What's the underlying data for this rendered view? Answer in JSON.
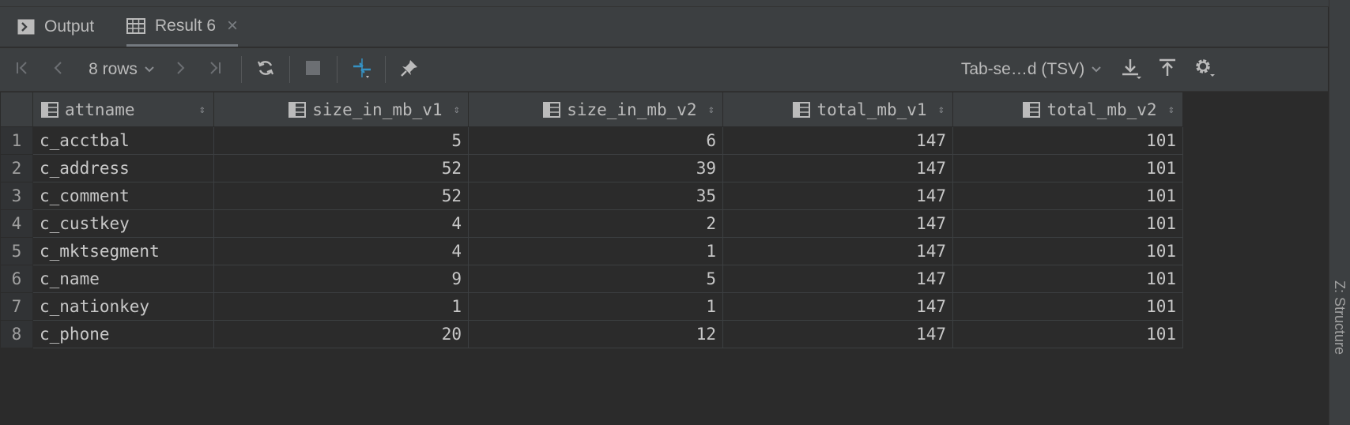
{
  "tabs": [
    {
      "label": "Output",
      "icon": "console-icon"
    },
    {
      "label": "Result 6",
      "icon": "table-icon",
      "close": "×"
    }
  ],
  "toolbar": {
    "rows_label": "8 rows",
    "format_label": "Tab-se…d (TSV)"
  },
  "side_panel": {
    "label": "Z: Structure"
  },
  "table": {
    "columns": [
      "attname",
      "size_in_mb_v1",
      "size_in_mb_v2",
      "total_mb_v1",
      "total_mb_v2"
    ],
    "rows": [
      [
        "1",
        "c_acctbal",
        "5",
        "6",
        "147",
        "101"
      ],
      [
        "2",
        "c_address",
        "52",
        "39",
        "147",
        "101"
      ],
      [
        "3",
        "c_comment",
        "52",
        "35",
        "147",
        "101"
      ],
      [
        "4",
        "c_custkey",
        "4",
        "2",
        "147",
        "101"
      ],
      [
        "5",
        "c_mktsegment",
        "4",
        "1",
        "147",
        "101"
      ],
      [
        "6",
        "c_name",
        "9",
        "5",
        "147",
        "101"
      ],
      [
        "7",
        "c_nationkey",
        "1",
        "1",
        "147",
        "101"
      ],
      [
        "8",
        "c_phone",
        "20",
        "12",
        "147",
        "101"
      ]
    ]
  },
  "colors": {
    "background": "#2b2b2b",
    "panel": "#3c3f41",
    "accent": "#3592c4"
  }
}
